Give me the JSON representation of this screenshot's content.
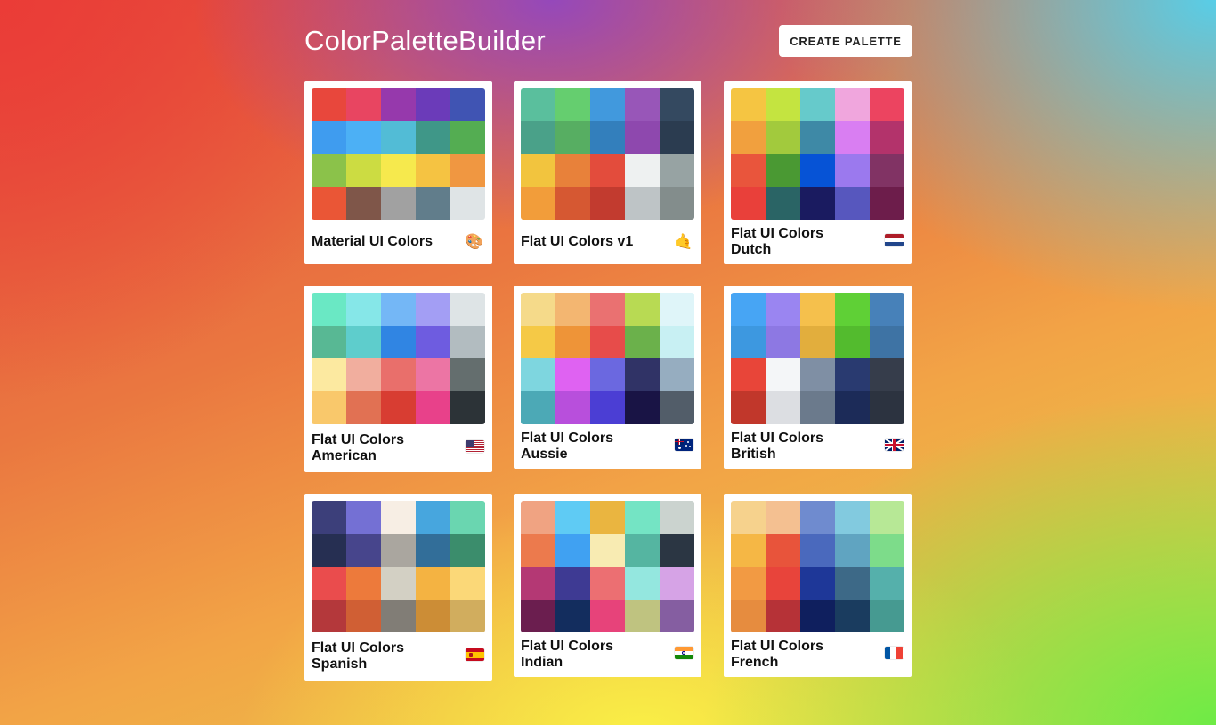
{
  "app": {
    "title": "ColorPaletteBuilder",
    "create_label": "CREATE PALETTE"
  },
  "palettes": [
    {
      "name": "Material UI Colors",
      "emoji": "🎨",
      "emoji_icon": "palette-icon",
      "colors": [
        "#e8473c",
        "#e84561",
        "#9639ac",
        "#6b3bb9",
        "#4054b3",
        "#3f9cef",
        "#4cb0f5",
        "#52bcd6",
        "#3f9788",
        "#54ad52",
        "#8bc24a",
        "#ccdc42",
        "#f6e94d",
        "#f5c342",
        "#f09741",
        "#ea5636",
        "#7f5649",
        "#a1a1a1",
        "#617d8b",
        "#dfe4e6"
      ]
    },
    {
      "name": "Flat UI Colors v1",
      "emoji": "🤙",
      "emoji_icon": "call-me-hand-icon",
      "colors": [
        "#5abf9d",
        "#65ce6f",
        "#4199dd",
        "#9856b8",
        "#344960",
        "#4aa189",
        "#57ae62",
        "#337fbc",
        "#8e48ae",
        "#2b3c50",
        "#f2c43e",
        "#e8813a",
        "#e34c3c",
        "#eef1f1",
        "#97a3a3",
        "#f29d3a",
        "#d65832",
        "#c23b2f",
        "#bec4c6",
        "#838d8c"
      ]
    },
    {
      "name": "Flat UI Colors Dutch",
      "emoji": "nl",
      "emoji_icon": "netherlands-flag-icon",
      "colors": [
        "#f5c542",
        "#c4e440",
        "#66cacb",
        "#f0a6dd",
        "#ec4460",
        "#f1a03e",
        "#a2ca3d",
        "#3e89a6",
        "#d97ef2",
        "#b3336b",
        "#e9553c",
        "#4a9933",
        "#0653d6",
        "#9b79ee",
        "#813364",
        "#e9403a",
        "#2a6465",
        "#1a1b60",
        "#5757be",
        "#6d1d4b"
      ]
    },
    {
      "name": "Flat UI Colors American",
      "emoji": "us",
      "emoji_icon": "united-states-flag-icon",
      "colors": [
        "#6ae8c4",
        "#86e7e8",
        "#74b7f6",
        "#a39ef4",
        "#dee4e6",
        "#58b894",
        "#5ecdcc",
        "#3085e3",
        "#6e5ce0",
        "#b2bcc0",
        "#fce9a0",
        "#f1ae9e",
        "#e96f6b",
        "#ec75a4",
        "#646e6e",
        "#f9c86b",
        "#e17153",
        "#d83d32",
        "#e8418a",
        "#2c3337"
      ]
    },
    {
      "name": "Flat UI Colors Aussie",
      "emoji": "au",
      "emoji_icon": "australia-flag-icon",
      "colors": [
        "#f5da8a",
        "#f3b671",
        "#ea7171",
        "#b8da53",
        "#dff5f9",
        "#f5c946",
        "#ee9438",
        "#e74c4a",
        "#6bb14b",
        "#c8f0f3",
        "#7ed6df",
        "#df62f2",
        "#6b68e0",
        "#303366",
        "#96adc0",
        "#4ca9b6",
        "#b84fdc",
        "#4b3ed4",
        "#191445",
        "#525d69"
      ]
    },
    {
      "name": "Flat UI Colors British",
      "emoji": "gb",
      "emoji_icon": "united-kingdom-flag-icon",
      "colors": [
        "#47a5f4",
        "#9a85f1",
        "#f5c04c",
        "#5fd036",
        "#4781b9",
        "#3d98e0",
        "#8d78e3",
        "#e2ae3d",
        "#53bb2e",
        "#3e73a4",
        "#e84539",
        "#f4f6f8",
        "#7f8fa4",
        "#293a70",
        "#363d4b",
        "#c1372b",
        "#dcdee2",
        "#6b7a8c",
        "#1c2b58",
        "#2c3340"
      ]
    },
    {
      "name": "Flat UI Colors Spanish",
      "emoji": "es",
      "emoji_icon": "spain-flag-icon",
      "colors": [
        "#3c3f7a",
        "#7470d4",
        "#f7eee4",
        "#47a6de",
        "#6ad6b0",
        "#262f52",
        "#47458c",
        "#aaa69f",
        "#326e99",
        "#3b8d6c",
        "#ea4c4d",
        "#ed7a3b",
        "#d3d0c4",
        "#f4b342",
        "#fbd878",
        "#b4383b",
        "#d05f34",
        "#817d76",
        "#cc8d36",
        "#d1ad5e"
      ]
    },
    {
      "name": "Flat UI Colors Indian",
      "emoji": "in",
      "emoji_icon": "india-flag-icon",
      "colors": [
        "#f0a382",
        "#5fcbf4",
        "#eab540",
        "#74e4c4",
        "#cbd3cf",
        "#ec7a4d",
        "#40a1f2",
        "#f8ebb2",
        "#55b5a1",
        "#2b3643",
        "#b43874",
        "#3e3a93",
        "#ec6f72",
        "#94e7df",
        "#d6a3e6",
        "#6b1e4f",
        "#132d5e",
        "#e7437a",
        "#bfc380",
        "#855ea1"
      ]
    },
    {
      "name": "Flat UI Colors French",
      "emoji": "fr",
      "emoji_icon": "france-flag-icon",
      "colors": [
        "#f6d28d",
        "#f4c091",
        "#6f8bcf",
        "#82cadf",
        "#b7e896",
        "#f5b745",
        "#e8543b",
        "#4a69bd",
        "#60a4c1",
        "#7ddc8a",
        "#f29a43",
        "#e8443b",
        "#1e3798",
        "#3d6987",
        "#55b0ab",
        "#e68c3f",
        "#b63237",
        "#0f1f5e",
        "#1a3c5f",
        "#469a91"
      ]
    }
  ]
}
